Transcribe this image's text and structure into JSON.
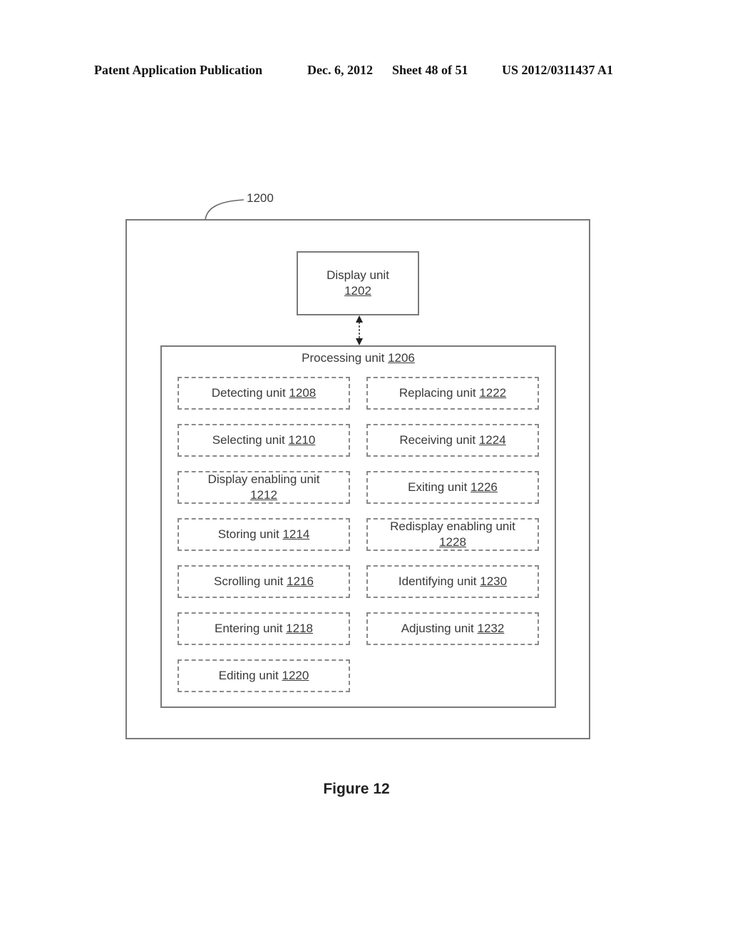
{
  "header": {
    "publication": "Patent Application Publication",
    "date": "Dec. 6, 2012",
    "sheet": "Sheet 48 of 51",
    "number": "US 2012/0311437 A1"
  },
  "figure": {
    "device_ref": "1200",
    "display_unit": {
      "label": "Display unit",
      "ref": "1202"
    },
    "processing_unit": {
      "label": "Processing unit ",
      "ref": "1206"
    },
    "units_left": [
      {
        "label": "Detecting unit ",
        "ref": "1208"
      },
      {
        "label": "Selecting unit ",
        "ref": "1210"
      },
      {
        "label": "Display enabling unit",
        "ref": "1212",
        "two_line": true
      },
      {
        "label": "Storing unit ",
        "ref": "1214"
      },
      {
        "label": "Scrolling unit ",
        "ref": "1216"
      },
      {
        "label": "Entering unit ",
        "ref": "1218"
      },
      {
        "label": "Editing unit ",
        "ref": "1220"
      }
    ],
    "units_right": [
      {
        "label": "Replacing unit ",
        "ref": "1222"
      },
      {
        "label": "Receiving unit ",
        "ref": "1224"
      },
      {
        "label": "Exiting unit ",
        "ref": "1226"
      },
      {
        "label": "Redisplay enabling unit",
        "ref": "1228",
        "two_line": true
      },
      {
        "label": "Identifying unit ",
        "ref": "1230"
      },
      {
        "label": "Adjusting unit ",
        "ref": "1232"
      }
    ],
    "caption": "Figure 12"
  }
}
